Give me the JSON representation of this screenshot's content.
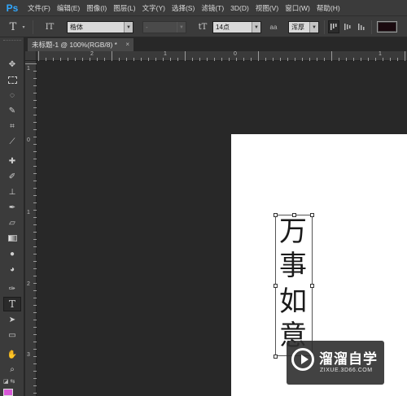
{
  "app": {
    "logo": "Ps"
  },
  "menu": [
    "文件(F)",
    "编辑(E)",
    "图像(I)",
    "图层(L)",
    "文字(Y)",
    "选择(S)",
    "滤镜(T)",
    "3D(D)",
    "视图(V)",
    "窗口(W)",
    "帮助(H)"
  ],
  "options": {
    "tool_icon": "T",
    "orientation_icon": "IT",
    "font_family": "楷体",
    "font_style": "-",
    "size_icon": "tT",
    "font_size": "14点",
    "aa_icon": "aa",
    "antialias": "浑厚",
    "text_color": "#1a0a0f"
  },
  "document": {
    "tab_title": "未标题-1 @ 100%(RGB/8) *",
    "close": "×"
  },
  "rulers": {
    "h": [
      "2",
      "1",
      "0",
      "1"
    ],
    "v": [
      "1",
      "0",
      "1",
      "2",
      "3"
    ]
  },
  "canvas_text": [
    "万",
    "事",
    "如",
    "意"
  ],
  "watermark": {
    "title": "溜溜自学",
    "subtitle": "ZIXUE.3D66.COM"
  },
  "colors": {
    "foreground": "#d858d8",
    "background": "#ffffff",
    "panel": "#3b3b3b",
    "workspace": "#282828"
  },
  "tools": [
    "move-icon",
    "marquee-icon",
    "lasso-icon",
    "quick-select-icon",
    "crop-icon",
    "eyedropper-icon",
    "healing-icon",
    "brush-icon",
    "stamp-icon",
    "history-brush-icon",
    "eraser-icon",
    "gradient-icon",
    "blur-icon",
    "dodge-icon",
    "pen-icon",
    "type-icon",
    "path-select-icon",
    "shape-icon",
    "hand-icon",
    "zoom-icon"
  ]
}
